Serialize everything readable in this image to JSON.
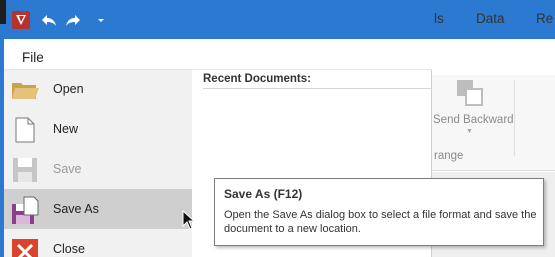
{
  "quick_access": {
    "logo_icon": "app-logo-icon",
    "undo_icon": "undo-icon",
    "redo_icon": "redo-icon",
    "customize_icon": "chevron-down-icon",
    "color": "#2b79d0"
  },
  "ribbon": {
    "tab_partial": "ls",
    "tab_data": "Data",
    "tab_partial_right": "Re",
    "send_backward_label": "Send Backward",
    "group_label_partial": "range"
  },
  "backstage": {
    "file_label": "File",
    "recent_title": "Recent Documents:",
    "items": [
      {
        "label": "Open",
        "icon": "open-folder-icon",
        "enabled": true
      },
      {
        "label": "New",
        "icon": "new-document-icon",
        "enabled": true
      },
      {
        "label": "Save",
        "icon": "save-icon",
        "enabled": false
      },
      {
        "label": "Save As",
        "icon": "save-as-icon",
        "enabled": true,
        "highlighted": true
      },
      {
        "label": "Close",
        "icon": "close-icon",
        "enabled": true
      }
    ]
  },
  "tooltip": {
    "title": "Save As (F12)",
    "body": "Open the Save As dialog box to select a file format and save the document to a new location."
  }
}
